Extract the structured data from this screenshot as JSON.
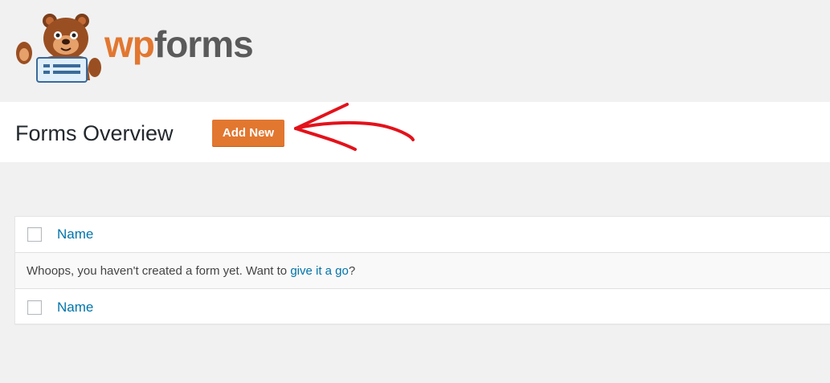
{
  "brand": {
    "logo_wp": "wp",
    "logo_forms": "forms",
    "accent_color": "#e27730",
    "mascot": "bear-mascot-icon"
  },
  "header": {
    "title": "Forms Overview",
    "add_new_label": "Add New"
  },
  "annotation": {
    "arrow_color": "#e3121b"
  },
  "table": {
    "column_header": "Name",
    "column_footer": "Name",
    "empty_message_prefix": "Whoops, you haven't created a form yet. Want to ",
    "empty_message_link": "give it a go",
    "empty_message_suffix": "?"
  }
}
